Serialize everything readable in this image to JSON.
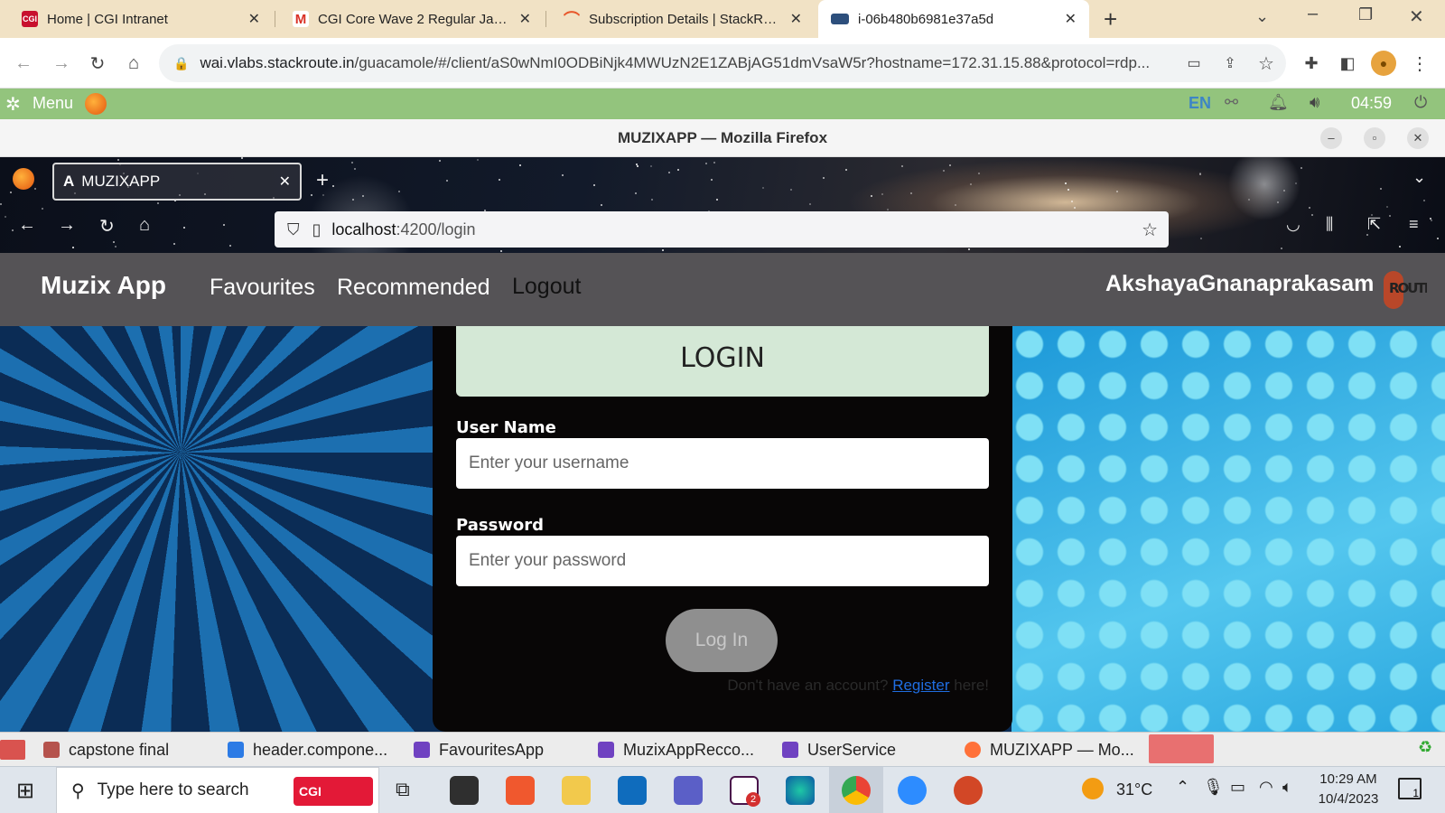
{
  "chrome": {
    "tabs": [
      {
        "label": "Home | CGI Intranet",
        "icon": "cgi-icon"
      },
      {
        "label": "CGI Core Wave 2 Regular Java B",
        "icon": "gmail-icon"
      },
      {
        "label": "Subscription Details | StackRoute",
        "icon": "stackroute-icon"
      },
      {
        "label": "i-06b480b6981e37a5d",
        "icon": "vm-icon",
        "active": true
      }
    ],
    "url": "wai.vlabs.stackroute.in/guacamole/#/client/aS0wNmI0ODBiNjk4MWUzN2E1ZABjAG51dmVsaW5r?hostname=172.31.15.88&protocol=rdp...",
    "url_host": "wai.vlabs.stackroute.in",
    "url_path": "/guacamole/#/client/aS0wNmI0ODBiNjk4MWUzN2E1ZABjAG51dmVsaW5r?hostname=172.31.15.88&protocol=rdp..."
  },
  "desktop_panel": {
    "menu_label": "Menu",
    "lang": "EN",
    "time": "04:59"
  },
  "firefox": {
    "window_title": "MUZIXAPP — Mozilla Firefox",
    "tab_title": "MUZIXAPP",
    "url_host": "localhost",
    "url_rest": ":4200/login"
  },
  "app": {
    "brand": "Muzix App",
    "nav": [
      "Favourites",
      "Recommended",
      "Logout"
    ],
    "username": "AkshayaGnanaprakasam",
    "logo_text": "ROUTE",
    "login_title": "LOGIN",
    "user_label": "User Name",
    "user_placeholder": "Enter your username",
    "pass_label": "Password",
    "pass_placeholder": "Enter your password",
    "login_button": "Log In",
    "register_prefix": "Don't have an account?",
    "register_link": "Register",
    "register_suffix": "here!"
  },
  "desktop_taskbar": [
    {
      "label": "capstone final",
      "color": "#d9534f"
    },
    {
      "label": "header.compone...",
      "color": "#2c7be5"
    },
    {
      "label": "FavouritesApp",
      "color": "#6f42c1"
    },
    {
      "label": "MuzixAppRecco...",
      "color": "#6f42c1"
    },
    {
      "label": "UserService",
      "color": "#6f42c1"
    },
    {
      "label": "MUZIXAPP — Mo...",
      "color": "#ff7139"
    }
  ],
  "windows": {
    "search_placeholder": "Type here to search",
    "search_badge": "CGI",
    "weather": "31°C",
    "time": "10:29 AM",
    "date": "10/4/2023",
    "notifications": "1",
    "slack_badge": "2"
  }
}
